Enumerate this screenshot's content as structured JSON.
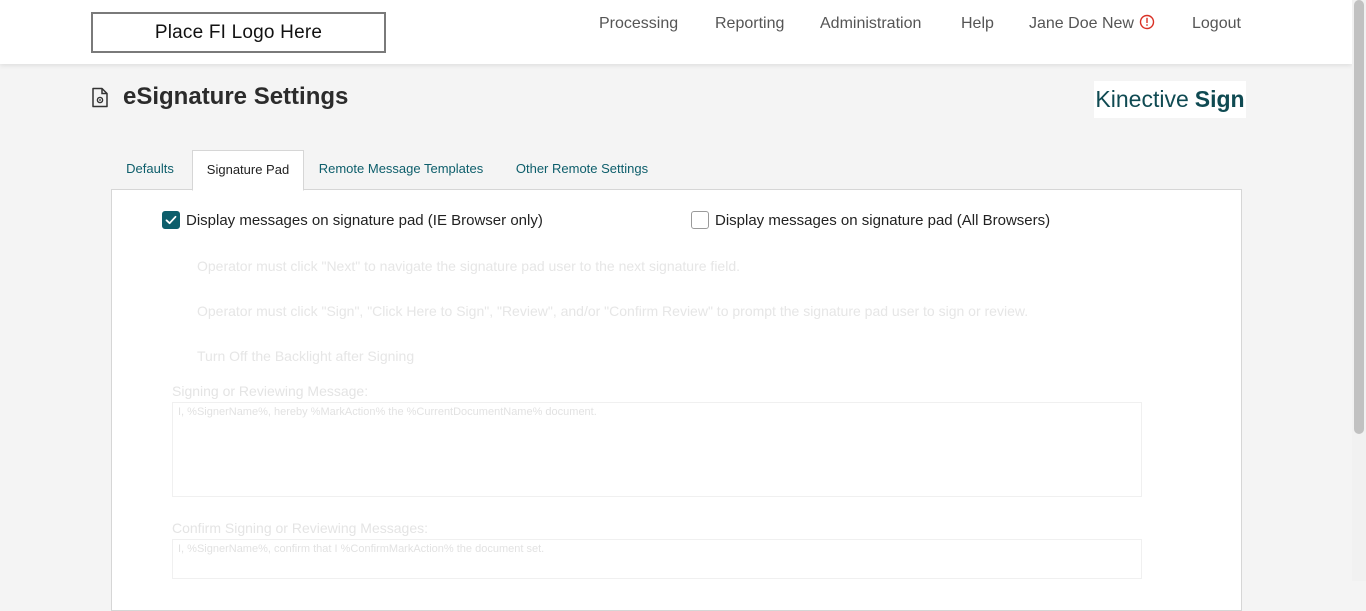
{
  "header": {
    "logo_placeholder": "Place FI Logo Here",
    "nav": {
      "processing": "Processing",
      "reporting": "Reporting",
      "administration": "Administration",
      "help": "Help",
      "user": "Jane Doe New",
      "logout": "Logout"
    },
    "user_alert_icon": "alert-circle-icon",
    "alert_color": "#d93025"
  },
  "page": {
    "title": "eSignature Settings",
    "title_icon": "document-settings-icon",
    "brand_light": "Kinective",
    "brand_bold": "Sign"
  },
  "tabs": [
    "Defaults",
    "Signature Pad",
    "Remote Message Templates",
    "Other Remote Settings"
  ],
  "active_tab": "Signature Pad",
  "accent_color": "#0d5e6b",
  "signature_pad": {
    "option_ie": {
      "label": "Display messages on signature pad (IE Browser only)",
      "checked": true
    },
    "option_all": {
      "label": "Display messages on signature pad (All Browsers)",
      "checked": false
    },
    "disabled_options": [
      "Operator must click \"Next\" to navigate the signature pad user to the next signature field.",
      "Operator must click \"Sign\", \"Click Here to Sign\", \"Review\", and/or \"Confirm Review\" to prompt the signature pad user to sign or review.",
      "Turn Off the Backlight after Signing"
    ],
    "signing_message": {
      "label": "Signing or Reviewing Message:",
      "value": "I, %SignerName%, hereby %MarkAction% the %CurrentDocumentName% document."
    },
    "confirm_message": {
      "label": "Confirm Signing or Reviewing Messages:",
      "value": "I, %SignerName%, confirm that I %ConfirmMarkAction% the document set."
    }
  }
}
